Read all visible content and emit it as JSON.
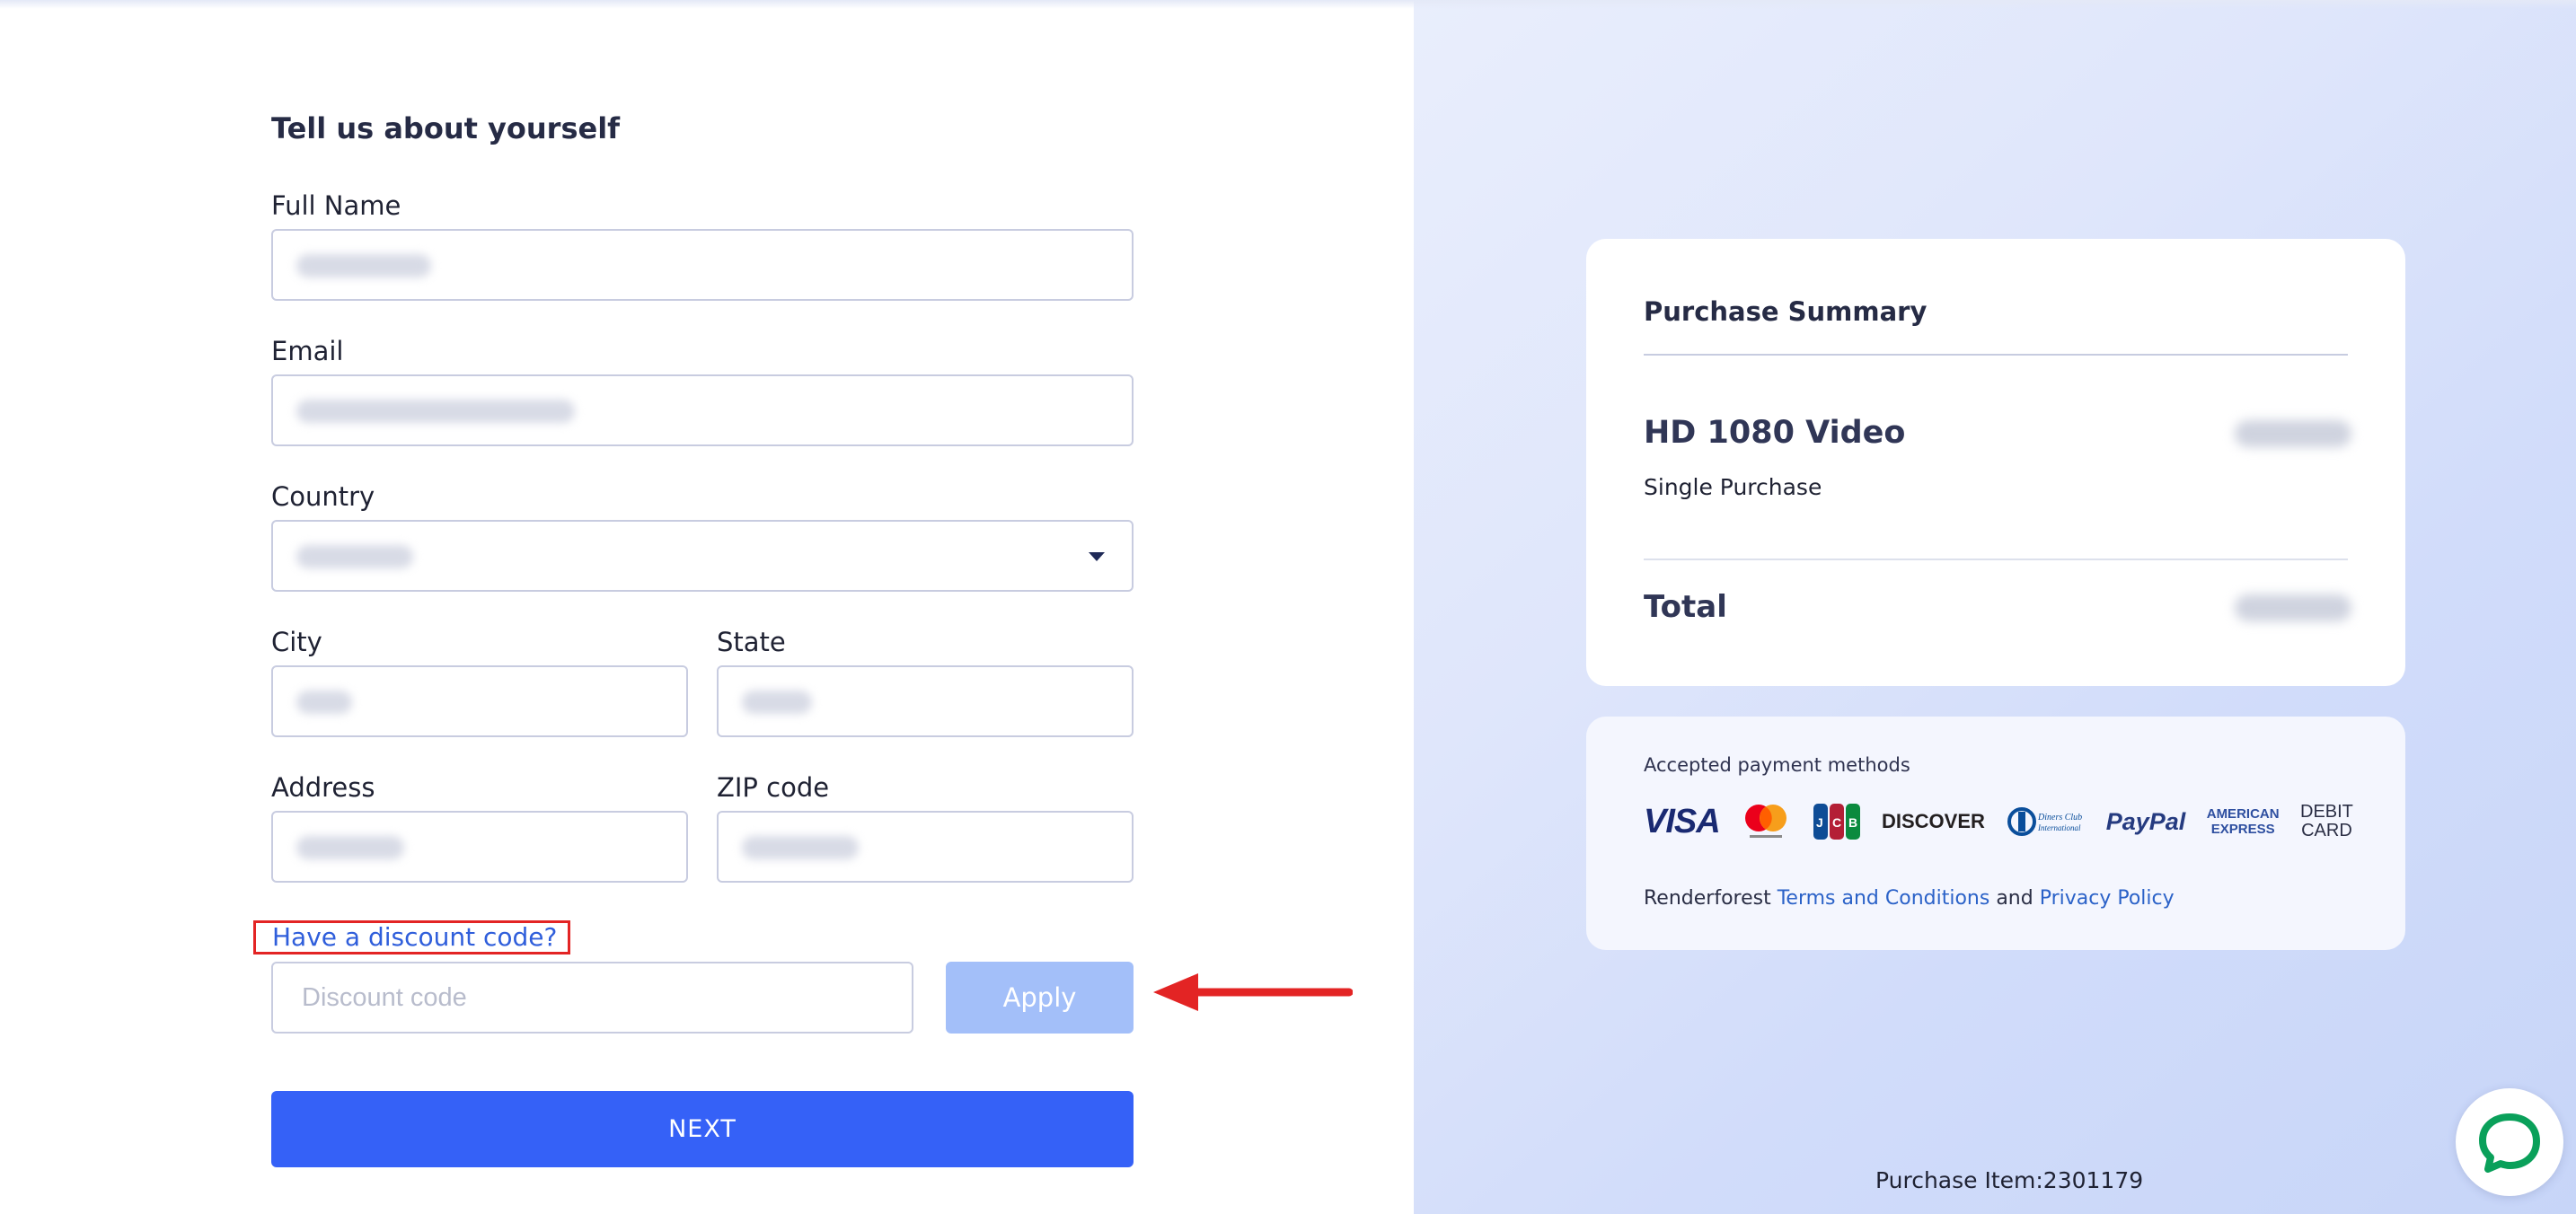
{
  "form": {
    "heading": "Tell us about yourself",
    "full_name": {
      "label": "Full Name",
      "value": ""
    },
    "email": {
      "label": "Email",
      "value": ""
    },
    "country": {
      "label": "Country",
      "value": ""
    },
    "city": {
      "label": "City",
      "value": ""
    },
    "state": {
      "label": "State",
      "value": ""
    },
    "address": {
      "label": "Address",
      "value": ""
    },
    "zip": {
      "label": "ZIP code",
      "value": ""
    },
    "discount_link": "Have a discount code?",
    "discount_placeholder": "Discount code",
    "apply_label": "Apply",
    "next_label": "NEXT"
  },
  "summary": {
    "title": "Purchase Summary",
    "item_name": "HD 1080 Video",
    "item_type": "Single Purchase",
    "total_label": "Total"
  },
  "payment": {
    "title": "Accepted payment methods",
    "methods": [
      "VISA",
      "Mastercard",
      "JCB",
      "DISCOVER",
      "Diners Club International",
      "PayPal",
      "AMERICAN EXPRESS",
      "DEBIT CARD"
    ],
    "legal_prefix": "Renderforest",
    "terms_label": "Terms and Conditions",
    "and_text": "and",
    "privacy_label": "Privacy Policy"
  },
  "purchase_item": "Purchase Item:2301179",
  "colors": {
    "primary": "#3561f7",
    "apply_disabled": "#a3bff9",
    "link": "#2b62c8",
    "annotation_red": "#e32424"
  }
}
